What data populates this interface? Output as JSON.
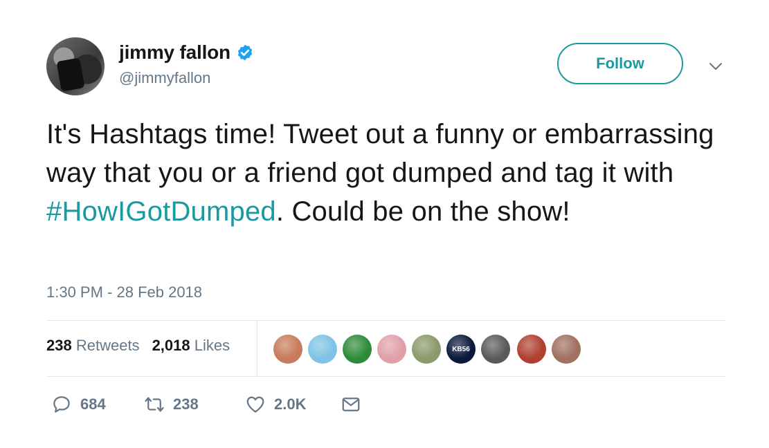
{
  "user": {
    "display_name": "jimmy fallon",
    "handle": "@jimmyfallon",
    "verified": true
  },
  "follow_button": {
    "label": "Follow"
  },
  "tweet": {
    "text_before": "It's Hashtags time! Tweet out a funny or embarrassing way that you or a friend got dumped and tag it with ",
    "hashtag": "#HowIGotDumped",
    "text_after": ". Could be on the show!",
    "timestamp": "1:30 PM - 28 Feb 2018"
  },
  "stats": {
    "retweets": "238",
    "retweets_label": "Retweets",
    "likes": "2,018",
    "likes_label": "Likes"
  },
  "liker_avatars": [
    {
      "name": "liker-avatar-1",
      "color": "#c77b5a"
    },
    {
      "name": "liker-avatar-whale",
      "color": "#7ec3e6"
    },
    {
      "name": "liker-avatar-3",
      "color": "#2e8b3a"
    },
    {
      "name": "liker-avatar-4",
      "color": "#e0a0a8"
    },
    {
      "name": "liker-avatar-5",
      "color": "#8a9a6a"
    },
    {
      "name": "liker-avatar-kb56",
      "color": "#0b1a3a",
      "text": "KB56"
    },
    {
      "name": "liker-avatar-7",
      "color": "#5a5a5a"
    },
    {
      "name": "liker-avatar-8",
      "color": "#b04030"
    },
    {
      "name": "liker-avatar-9",
      "color": "#a07060"
    }
  ],
  "actions": {
    "replies": "684",
    "retweets": "238",
    "likes": "2.0K"
  },
  "colors": {
    "accent": "#1a9aa0",
    "verified": "#1da1f2",
    "muted": "#657786",
    "divider": "#e1e8ed"
  }
}
